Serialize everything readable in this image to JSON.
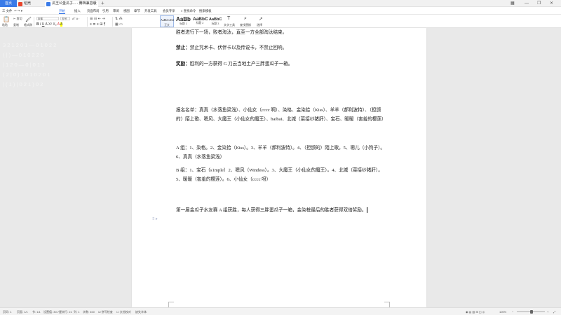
{
  "tabs": {
    "home": "首页",
    "straw": "稻壳",
    "doc": "瓜王公金瓜子... - 腾档兼容版",
    "new_tab": "+"
  },
  "window": {
    "minimize": "—",
    "restore": "❐",
    "close": "✕"
  },
  "menu": {
    "file": "三 文件",
    "items": [
      "开始",
      "插入",
      "页面布局",
      "引用",
      "审阅",
      "视图",
      "章节",
      "开发工具",
      "会员专享"
    ],
    "search": "查找命令",
    "search2": "搜索模板",
    "upgrade": "立即登录",
    "share": "分享"
  },
  "ribbon": {
    "paste": "粘贴",
    "cut": "剪切",
    "copy": "复制",
    "format_painter": "格式刷",
    "font_name": "宋体",
    "font_size": "五号",
    "styles": [
      {
        "sample": "AaBbCcDd",
        "name": "正文"
      },
      {
        "sample": "AaBb",
        "name": "标题 1"
      },
      {
        "sample": "AaBbC",
        "name": "标题 2"
      },
      {
        "sample": "AaBbC",
        "name": "标题 3"
      }
    ],
    "text_tools": "文字工具",
    "find_replace": "查找替换",
    "select": "选择"
  },
  "document": {
    "line1": "胜者进行下一场，败者淘汰，直至一方全部淘汰结束。",
    "ban_label": "禁止：",
    "ban_text": "禁止咒术卡、伏伴卡以及传说卡，不禁止回响。",
    "reward_label": "奖励：",
    "reward_text": "胜利的一方获得 G 刀云当地土产三胖蛋瓜子一箱。",
    "roster": "报名名单：真真（水落鱼梁浅）、小仙女（cccc 啊）、染格、金染拾（Kiss）、羊羊（郝利波特）、（担颁的）陌上歌、嗯风、大魔王（小仙女的魔王）、baibai、北城（菜接纱猪肝）、宝石、暧暧（害羞的樱莲）",
    "group_a": "A 组：1、染格。2、金染拾（Kiss）。3、羊羊（郝利波特）。4、（担颁的）陌上歌。5、嗯儿（小狗子）。6、真真（水落鱼梁浅）",
    "group_b": "B 组：1、宝石（s1mple）2、嗯风（Windess）。3、大魔王（小仙女的魔王）。4、北城（菜接纱猪肝）。5、暧暧（害羞的樱莲）。6、小仙女（cccc 呀）",
    "final": "第一届金瓜子水友赛 A 组获胜，每人获得三胖蛋瓜子一箱，金染桩最后的胜者获得双倍奖励。"
  },
  "status": {
    "page": "页码: 1",
    "pages": "页面: 1/1",
    "section": "节: 1/1",
    "position": "设置值: 30.7厘米",
    "line": "行: 21",
    "col": "列: 1",
    "words": "字数: 400",
    "spell": "拼写检查",
    "doc_check": "文档校对",
    "missing_font": "缺失字体",
    "zoom": "100%"
  }
}
